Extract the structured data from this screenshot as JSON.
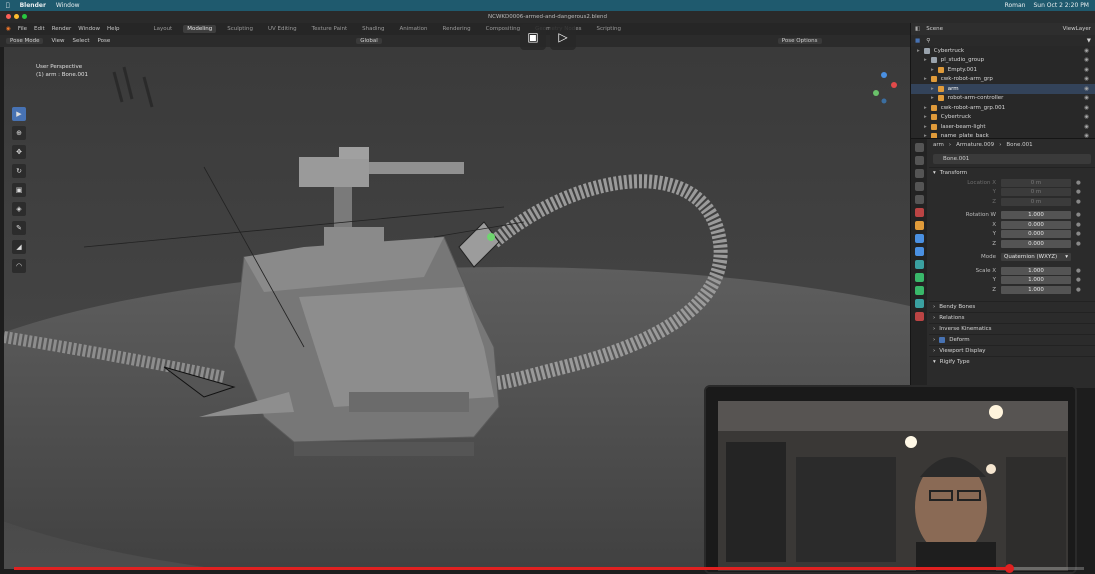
{
  "mac_menubar": {
    "app": "Blender",
    "menu": "Window",
    "user": "Roman",
    "clock": "Sun Oct 2  2:20 PM"
  },
  "window": {
    "title": "NCWKD0006-armed-and-dangerous2.blend"
  },
  "topbar": {
    "menus": [
      "File",
      "Edit",
      "Render",
      "Window",
      "Help"
    ],
    "workspaces": [
      "Layout",
      "Modeling",
      "Sculpting",
      "UV Editing",
      "Texture Paint",
      "Shading",
      "Animation",
      "Rendering",
      "Compositing",
      "Geometry Nodes",
      "Scripting"
    ],
    "active_workspace": "Modeling",
    "scene": "Scene",
    "view_layer": "ViewLayer"
  },
  "viewport_header": {
    "mode": "Pose Mode",
    "menus": [
      "View",
      "Select",
      "Pose"
    ],
    "orientation": "Global",
    "pose_options": "Pose Options"
  },
  "viewport": {
    "perspective": "User Perspective",
    "active": "(1) arm : Bone.001"
  },
  "tools": [
    "select",
    "cursor",
    "move",
    "rotate",
    "scale",
    "transform",
    "annotate",
    "measure",
    "pose"
  ],
  "outliner": {
    "rows": [
      {
        "label": "Cybertruck",
        "color": "#d8d8d8",
        "icon": "#9aa3ad",
        "depth": 0,
        "selected": false
      },
      {
        "label": "pl_studio_group",
        "color": "#d8d8d8",
        "icon": "#9aa3ad",
        "depth": 1,
        "selected": false
      },
      {
        "label": "Empty.001",
        "color": "#d8d8d8",
        "icon": "#e09b3a",
        "depth": 2,
        "selected": false
      },
      {
        "label": "cwk-robot-arm_grp",
        "color": "#d8d8d8",
        "icon": "#e09b3a",
        "depth": 1,
        "selected": false
      },
      {
        "label": "arm",
        "color": "#ffffff",
        "icon": "#e09b3a",
        "depth": 2,
        "selected": true
      },
      {
        "label": "robot-arm-controller",
        "color": "#d8d8d8",
        "icon": "#e09b3a",
        "depth": 2,
        "selected": false
      },
      {
        "label": "cwk-robot-arm_grp.001",
        "color": "#d8d8d8",
        "icon": "#e09b3a",
        "depth": 1,
        "selected": false
      },
      {
        "label": "Cybertruck",
        "color": "#d8d8d8",
        "icon": "#e09b3a",
        "depth": 1,
        "selected": false
      },
      {
        "label": "laser-beam-light",
        "color": "#d8d8d8",
        "icon": "#e09b3a",
        "depth": 1,
        "selected": false
      },
      {
        "label": "name_plate_back",
        "color": "#d8d8d8",
        "icon": "#e09b3a",
        "depth": 1,
        "selected": false
      }
    ]
  },
  "properties": {
    "breadcrumb": [
      "arm",
      "Armature.009",
      "Bone.001"
    ],
    "bone_name": "Bone.001",
    "transform_label": "Transform",
    "location": {
      "label": "Location X",
      "x": "0 m",
      "y": "0 m",
      "z": "0 m"
    },
    "rotation": {
      "label": "Rotation W",
      "w": "1.000",
      "x": "0.000",
      "y": "0.000",
      "z": "0.000"
    },
    "mode": {
      "label": "Mode",
      "value": "Quaternion (WXYZ)"
    },
    "scale": {
      "label": "Scale X",
      "x": "1.000",
      "y": "1.000",
      "z": "1.000"
    },
    "panels": [
      "Bendy Bones",
      "Relations",
      "Inverse Kinematics",
      "Deform",
      "Viewport Display",
      "Rigify Type"
    ]
  },
  "video": {
    "progress": 0.93
  },
  "colors": {
    "accent": "#4772b3",
    "progress": "#e02020",
    "menubar": "#1f5a6e"
  }
}
